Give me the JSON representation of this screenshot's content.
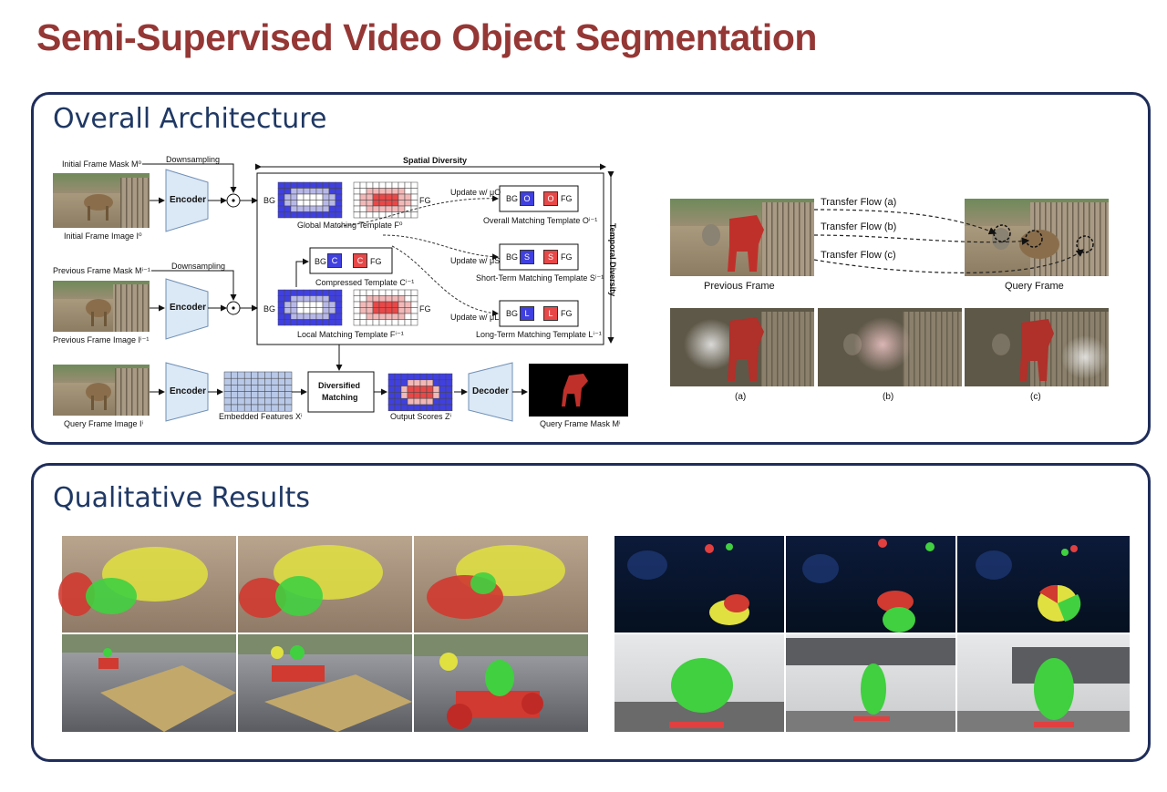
{
  "title": "Semi-Supervised Video Object Segmentation",
  "architecture": {
    "heading": "Overall Architecture",
    "labels": {
      "initial_mask": "Initial Frame Mask M⁰",
      "downsampling_1": "Downsampling",
      "initial_image": "Initial Frame Image I⁰",
      "prev_mask": "Previous Frame Mask Mⁱ⁻¹",
      "downsampling_2": "Downsampling",
      "prev_image": "Previous Frame Image Iⁱ⁻¹",
      "query_image": "Query Frame Image Iⁱ",
      "encoder": "Encoder",
      "spatial_diversity": "Spatial Diversity",
      "temporal_diversity": "Temporal Diversity",
      "global_template": "Global Matching Template F⁰",
      "local_template": "Local Matching Template Fⁱ⁻¹",
      "compressed_template": "Compressed Template Cⁱ⁻¹",
      "overall_template": "Overall Matching Template Oⁱ⁻¹",
      "short_template": "Short-Term Matching Template Sⁱ⁻¹",
      "long_template": "Long-Term Matching Template Lⁱ⁻¹",
      "update_o": "Update w/ μO",
      "update_s": "Update w/ μS",
      "update_l": "Update w/ μL",
      "bg": "BG",
      "fg": "FG",
      "c": "C",
      "o": "O",
      "s": "S",
      "l": "L",
      "embedded_features": "Embedded Features Xⁱ",
      "diversified_matching_1": "Diversified",
      "diversified_matching_2": "Matching",
      "output_scores": "Output Scores Zⁱ",
      "decoder": "Decoder",
      "query_mask": "Query Frame Mask Mⁱ"
    },
    "flow": {
      "transfer_a": "Transfer Flow (a)",
      "transfer_b": "Transfer Flow (b)",
      "transfer_c": "Transfer Flow (c)",
      "previous_frame": "Previous Frame",
      "query_frame": "Query Frame",
      "sub_a": "(a)",
      "sub_b": "(b)",
      "sub_c": "(c)"
    }
  },
  "results": {
    "heading": "Qualitative Results"
  },
  "colors": {
    "title": "#953735",
    "panel_border": "#1f2d5a",
    "heading": "#1f3864",
    "blue_cell": "#4040e0",
    "red_cell": "#e84848",
    "mask_red": "#c0302a",
    "mask_green": "#40d040",
    "mask_yellow": "#e0e040"
  }
}
